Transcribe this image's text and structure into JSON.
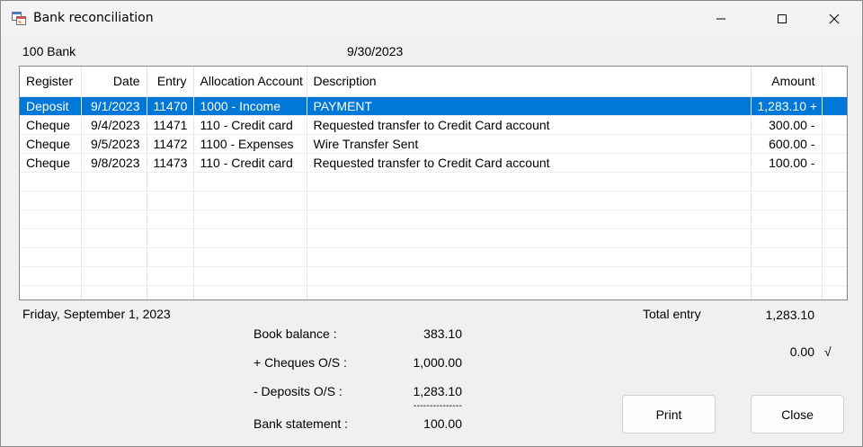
{
  "window": {
    "title": "Bank reconciliation"
  },
  "header": {
    "account": "100 Bank",
    "date": "9/30/2023"
  },
  "grid": {
    "columns": [
      "Register",
      "Date",
      "Entry",
      "Allocation Account",
      "Description",
      "Amount"
    ],
    "rows": [
      {
        "register": "Deposit",
        "date": "9/1/2023",
        "entry": "11470",
        "allocation": "1000 - Income",
        "description": "PAYMENT",
        "amount": "1,283.10 +"
      },
      {
        "register": "Cheque",
        "date": "9/4/2023",
        "entry": "11471",
        "allocation": "110 - Credit card",
        "description": "Requested transfer to Credit Card account",
        "amount": "300.00 -"
      },
      {
        "register": "Cheque",
        "date": "9/5/2023",
        "entry": "11472",
        "allocation": "1100 - Expenses",
        "description": "Wire Transfer Sent",
        "amount": "600.00 -"
      },
      {
        "register": "Cheque",
        "date": "9/8/2023",
        "entry": "11473",
        "allocation": "110 - Credit card",
        "description": "Requested transfer to Credit Card account",
        "amount": "100.00 -"
      }
    ],
    "selected_row": 0,
    "selection_color": "#0078d7"
  },
  "footer": {
    "selected_date": "Friday, September 1, 2023",
    "total_entry_label": "Total entry",
    "total_entry_value": "1,283.10",
    "difference_value": "0.00",
    "check_mark": "√"
  },
  "summary": {
    "book_balance_label": "Book balance :",
    "book_balance_value": "383.10",
    "cheques_label": "+ Cheques O/S :",
    "cheques_value": "1,000.00",
    "deposits_label": "- Deposits O/S :",
    "deposits_value": "1,283.10",
    "separator": "---------------",
    "bank_statement_label": "Bank statement :",
    "bank_statement_value": "100.00"
  },
  "buttons": {
    "print": "Print",
    "close": "Close"
  },
  "icons": {
    "app": "app-window-icon",
    "minimize": "minimize-icon",
    "maximize": "maximize-icon",
    "close": "close-icon"
  }
}
